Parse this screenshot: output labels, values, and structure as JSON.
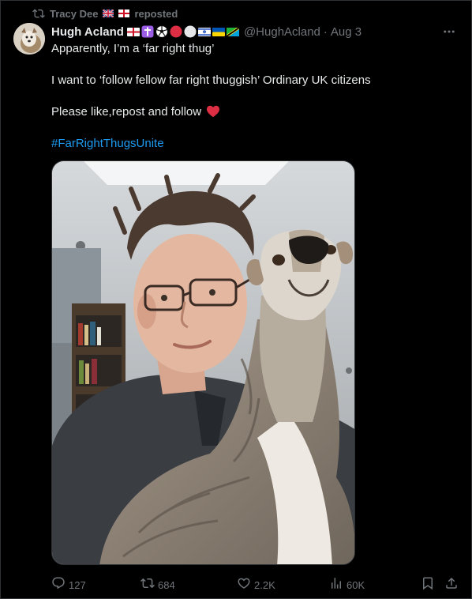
{
  "repost": {
    "user": "Tracy Dee",
    "label": "reposted"
  },
  "author": {
    "name": "Hugh Acland",
    "handle": "@HughAcland",
    "date": "Aug 3"
  },
  "post": {
    "line1": "Apparently, I’m a ‘far right thug’",
    "line2": "I want to ‘follow fellow far right thuggish’ Ordinary UK citizens",
    "line3": "Please like,repost and follow",
    "hashtag": "#FarRightThugsUnite"
  },
  "stats": {
    "replies": "127",
    "reposts": "684",
    "likes": "2.2K",
    "views": "60K"
  },
  "colors": {
    "background": "#000000",
    "text": "#e7e9ea",
    "muted": "#71767b",
    "link": "#1d9bf0",
    "heart": "#f91880"
  },
  "icons": [
    "repost-icon",
    "flag-uk-icon",
    "flag-england-icon",
    "cross-icon",
    "soccer-ball-icon",
    "red-circle-icon",
    "white-circle-icon",
    "flag-israel-icon",
    "flag-ukraine-icon",
    "flag-tanzania-icon",
    "more-icon",
    "red-heart-icon",
    "reply-icon",
    "like-icon",
    "views-icon",
    "bookmark-icon",
    "share-icon"
  ]
}
